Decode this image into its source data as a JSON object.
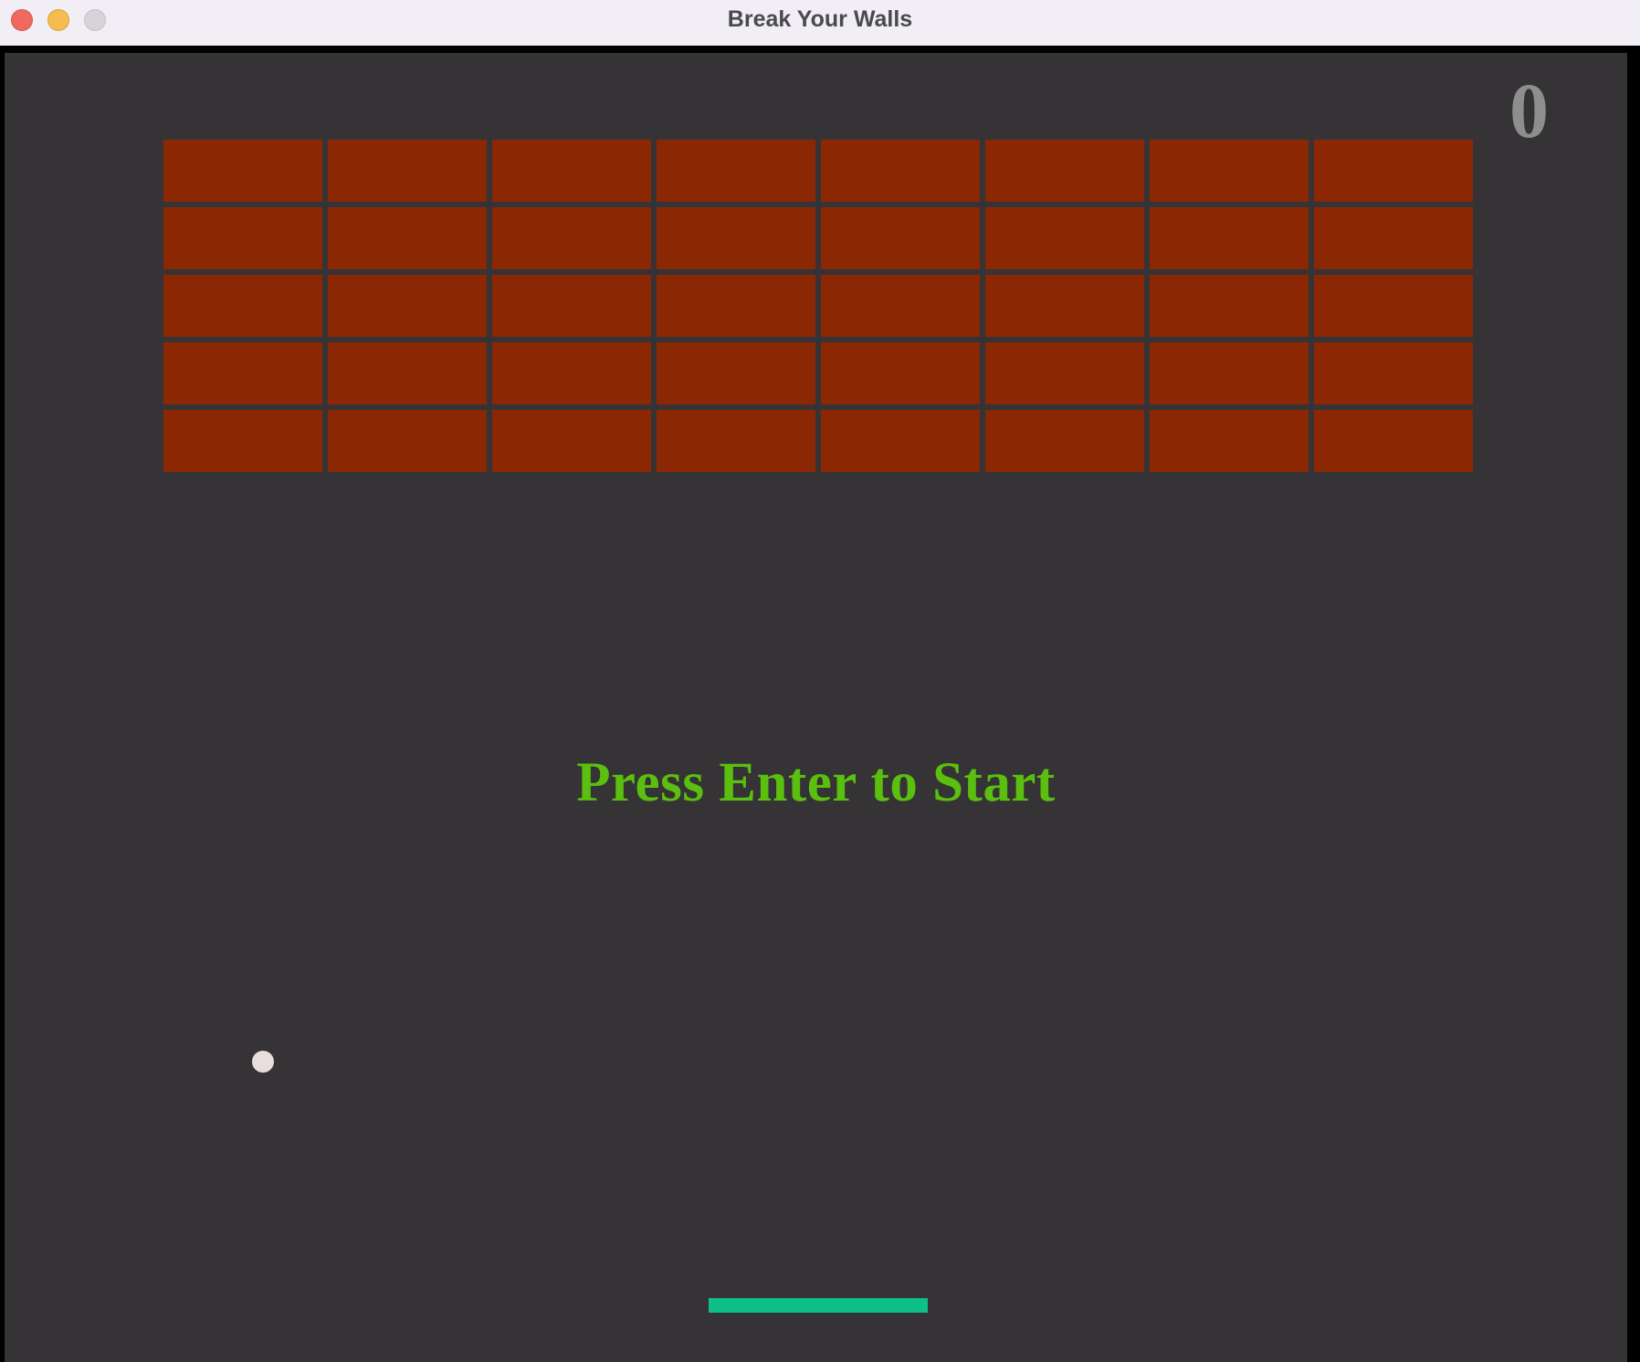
{
  "window": {
    "title": "Break Your Walls"
  },
  "game": {
    "score": "0",
    "prompt": "Press Enter to Start",
    "bricks": {
      "rows": 5,
      "columns": 8,
      "color": "#8c2703"
    },
    "background_color": "#353335",
    "ball_color": "#e9dede",
    "paddle_color": "#0ebf87",
    "prompt_color": "#5abf0e",
    "score_color": "#8e8e8e"
  }
}
